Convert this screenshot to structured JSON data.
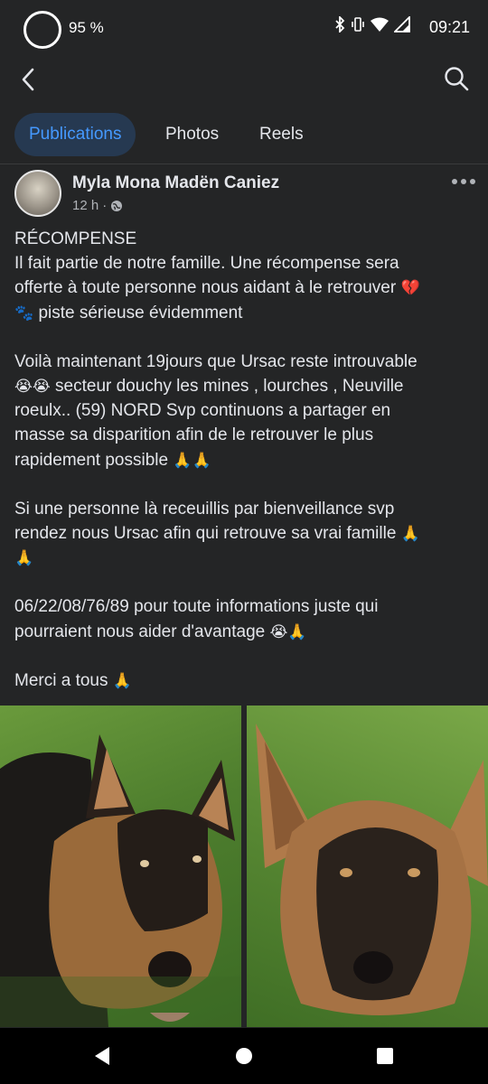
{
  "status_bar": {
    "battery": "95 %",
    "time": "09:21",
    "icons": [
      "bluetooth-icon",
      "vibrate-icon",
      "wifi-icon",
      "signal-icon"
    ]
  },
  "top_bar": {
    "back_icon": "chevron-left-icon",
    "search_icon": "search-icon"
  },
  "tabs": [
    {
      "label": "Publications",
      "active": true
    },
    {
      "label": "Photos",
      "active": false
    },
    {
      "label": "Reels",
      "active": false
    }
  ],
  "post": {
    "author": "Myla Mona Madën Caniez",
    "time": "12 h",
    "separator": "·",
    "audience_icon": "globe-icon",
    "body": {
      "p1_line1": "RÉCOMPENSE",
      "p1_line2": "Il fait partie de notre famille. Une récompense sera",
      "p1_line3": "offerte à toute personne nous aidant à le retrouver",
      "p1_line4": "piste sérieuse évidemment",
      "p2_line1": "Voilà maintenant 19jours que Ursac reste introuvable",
      "p2_line2": "secteur douchy les mines , lourches , Neuville",
      "p2_line3": "roeulx.. (59) NORD Svp continuons a partager en",
      "p2_line4": "masse sa disparition afin de le retrouver le plus",
      "p2_line5": "rapidement possible",
      "p3_line1": "Si une personne là receuillis par bienveillance svp",
      "p3_line2": "rendez nous Ursac afin qui retrouve sa vrai famille",
      "p4_line1": "06/22/08/76/89 pour toute informations juste qui",
      "p4_line2": "pourraient nous aider d'avantage",
      "p5_line1": "Merci a tous"
    },
    "emoji": {
      "broken_heart": "💔",
      "paw": "🐾",
      "cry": "😭",
      "pray": "🙏"
    }
  },
  "photos": [
    {
      "subject": "german-shepherd-puppy-lying"
    },
    {
      "subject": "german-shepherd-puppy-closeup"
    }
  ],
  "nav_bar": {
    "back": "triangle-back-icon",
    "home": "circle-home-icon",
    "recents": "square-recents-icon"
  }
}
